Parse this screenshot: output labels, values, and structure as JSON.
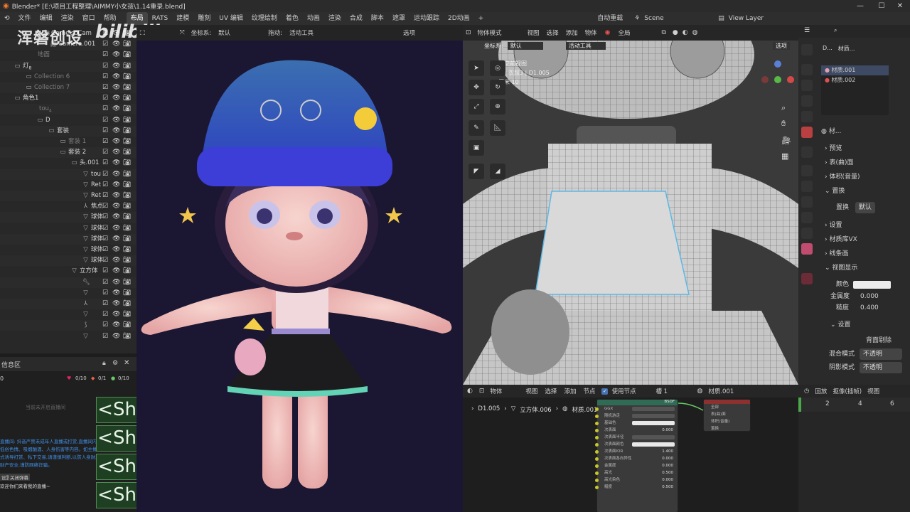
{
  "window": {
    "title": "Blender* [E:\\项目工程整理\\AIMMY小女孩\\1.14重录.blend]",
    "controls": [
      "—",
      "☐",
      "✕"
    ]
  },
  "menu": {
    "items": [
      "文件",
      "编辑",
      "渲染",
      "窗口",
      "帮助"
    ],
    "workspaces": [
      "布局",
      "RATS",
      "建模",
      "雕刻",
      "UV 编辑",
      "纹理绘制",
      "着色",
      "动画",
      "渲染",
      "合成",
      "脚本",
      "遮罩",
      "运动跟踪",
      "2D动画"
    ],
    "add_tab": "+",
    "autosave": "自动重载",
    "scene": "Scene",
    "view_layer": "View Layer"
  },
  "watermark": {
    "brand": "浑磐创设",
    "platform": "bilibili"
  },
  "outliner": {
    "rows": [
      {
        "indent": 60,
        "label": "GameIsoCam",
        "icon": "camera-icon"
      },
      {
        "indent": 70,
        "label": "Camera.001",
        "icon": "camera-icon"
      },
      {
        "indent": 50,
        "label": "地面",
        "dim": true
      },
      {
        "indent": 20,
        "label": "灯",
        "badge": "8",
        "icon": "collection-icon"
      },
      {
        "indent": 36,
        "label": "Collection 6",
        "dim": true,
        "icon": "collection-icon"
      },
      {
        "indent": 36,
        "label": "Collection 7",
        "dim": true,
        "icon": "collection-icon"
      },
      {
        "indent": 20,
        "label": "角色1",
        "icon": "collection-icon"
      },
      {
        "indent": 52,
        "label": "tou",
        "badge": "4",
        "dim": true
      },
      {
        "indent": 52,
        "label": "D",
        "icon": "collection-icon"
      },
      {
        "indent": 68,
        "label": "套装",
        "icon": "collection-icon"
      },
      {
        "indent": 84,
        "label": "套装 1",
        "dim": true,
        "icon": "collection-icon"
      },
      {
        "indent": 84,
        "label": "套装 2",
        "icon": "collection-icon"
      },
      {
        "indent": 100,
        "label": "头.001",
        "icon": "collection-icon"
      },
      {
        "indent": 116,
        "label": "tou",
        "icon": "mesh-icon"
      },
      {
        "indent": 116,
        "label": "Ret",
        "icon": "mesh-icon"
      },
      {
        "indent": 116,
        "label": "Ret",
        "icon": "mesh-icon"
      },
      {
        "indent": 116,
        "label": "焦点",
        "icon": "armature-icon"
      },
      {
        "indent": 116,
        "label": "球体",
        "icon": "mesh-icon"
      },
      {
        "indent": 116,
        "label": "球体",
        "icon": "mesh-icon"
      },
      {
        "indent": 116,
        "label": "球体",
        "icon": "mesh-icon"
      },
      {
        "indent": 116,
        "label": "球体",
        "icon": "mesh-icon"
      },
      {
        "indent": 116,
        "label": "球体",
        "icon": "mesh-icon"
      },
      {
        "indent": 100,
        "label": "立方体",
        "icon": "mesh-icon"
      },
      {
        "indent": 116,
        "label": "",
        "icon": "wrench-icon"
      },
      {
        "indent": 116,
        "label": "",
        "icon": "mesh-icon"
      },
      {
        "indent": 116,
        "label": "",
        "icon": "armature-icon"
      },
      {
        "indent": 116,
        "label": "",
        "icon": "mesh-icon"
      },
      {
        "indent": 116,
        "label": "",
        "icon": "curve-icon"
      },
      {
        "indent": 116,
        "label": "",
        "icon": "mesh-icon"
      }
    ]
  },
  "info_panel": {
    "title": "信息区",
    "counts": [
      "0/10",
      "0/1",
      "0/10"
    ],
    "hint": "当前未开启直播间",
    "messages": [
      "直播间: 抖音严禁未成年人直播或打赏,直播间内…",
      "低俗色情、吸烟酗酒、人身伤害等内容。如主播在直播过程中…",
      "式诱导打赏、私下交易,请谨慎判断,以防人身财产损失。",
      "财产安全,谨防网络诈骗。"
    ],
    "btn1": "设置",
    "btn2": "关闭弹幕",
    "footer": "欢迎你们来看我的直播~"
  },
  "shift_keys": [
    "<Shift>",
    "<Shift>",
    "<Shift>",
    "<Shift>"
  ],
  "viewport_left": {
    "coord_label": "坐标系:",
    "coord_value": "默认",
    "drag_label": "拖动:",
    "drag_value": "活动工具",
    "options": "选项"
  },
  "viewport_right": {
    "mode": "物体模式",
    "menus": [
      "视图",
      "选择",
      "添加",
      "物体"
    ],
    "transform": "全局",
    "coord_label": "坐标系:",
    "coord_value": "默认",
    "drag_value": "活动工具",
    "options": "选项",
    "info1": "正交前视图",
    "info2": "(0) 衣服3 | D1.005",
    "info3": "厘米 10"
  },
  "properties": {
    "breadcrumb_obj": "D...",
    "breadcrumb_mat": "材质...",
    "materials": [
      "材质.001",
      "材质.002"
    ],
    "mat_name": "材...",
    "sections": [
      "预览",
      "表(曲)面",
      "体积(音量)",
      "置换"
    ],
    "displacement_label": "置换",
    "displacement_value": "默认",
    "sections2": [
      "设置",
      "材质库VX",
      "线条画",
      "视图显示"
    ],
    "color_label": "颜色",
    "metallic_label": "金属度",
    "metallic_value": "0.000",
    "roughness_label": "糙度",
    "roughness_value": "0.400",
    "settings": "设置",
    "backface": "背面剔除",
    "blend_label": "混合模式",
    "blend_value": "不透明",
    "shadow_label": "阴影模式",
    "shadow_value": "不透明"
  },
  "node_editor": {
    "mode": "物体",
    "menus": [
      "视图",
      "选择",
      "添加",
      "节点"
    ],
    "use_nodes": "使用节点",
    "slot": "槽 1",
    "material": "材质.001",
    "breadcrumb": [
      "D1.005",
      "立方体.006",
      "材质.001"
    ],
    "bsdf_rows": [
      {
        "label": "GGX"
      },
      {
        "label": "随机游走"
      },
      {
        "label": "基础色"
      },
      {
        "label": "次表面",
        "value": "0.000"
      },
      {
        "label": "次表面半径"
      },
      {
        "label": "次表面颜色"
      },
      {
        "label": "次表面IOR",
        "value": "1.400"
      },
      {
        "label": "次表面各向异性",
        "value": "0.000"
      },
      {
        "label": "金属度",
        "value": "0.000"
      },
      {
        "label": "高光",
        "value": "0.500"
      },
      {
        "label": "高光染色",
        "value": "0.000"
      },
      {
        "label": "糙度",
        "value": "0.500"
      }
    ],
    "output_rows": [
      "全部",
      "表(曲)面",
      "体积(音量)",
      "置换"
    ]
  },
  "timeline": {
    "menus": [
      "回放",
      "抠像(插帧)",
      "视图"
    ],
    "frames": [
      "2",
      "4",
      "6"
    ]
  },
  "colors": {
    "accent": "#4772b3",
    "viewport_bg": "#1b1733",
    "shift_bg": "#1f3f22"
  }
}
